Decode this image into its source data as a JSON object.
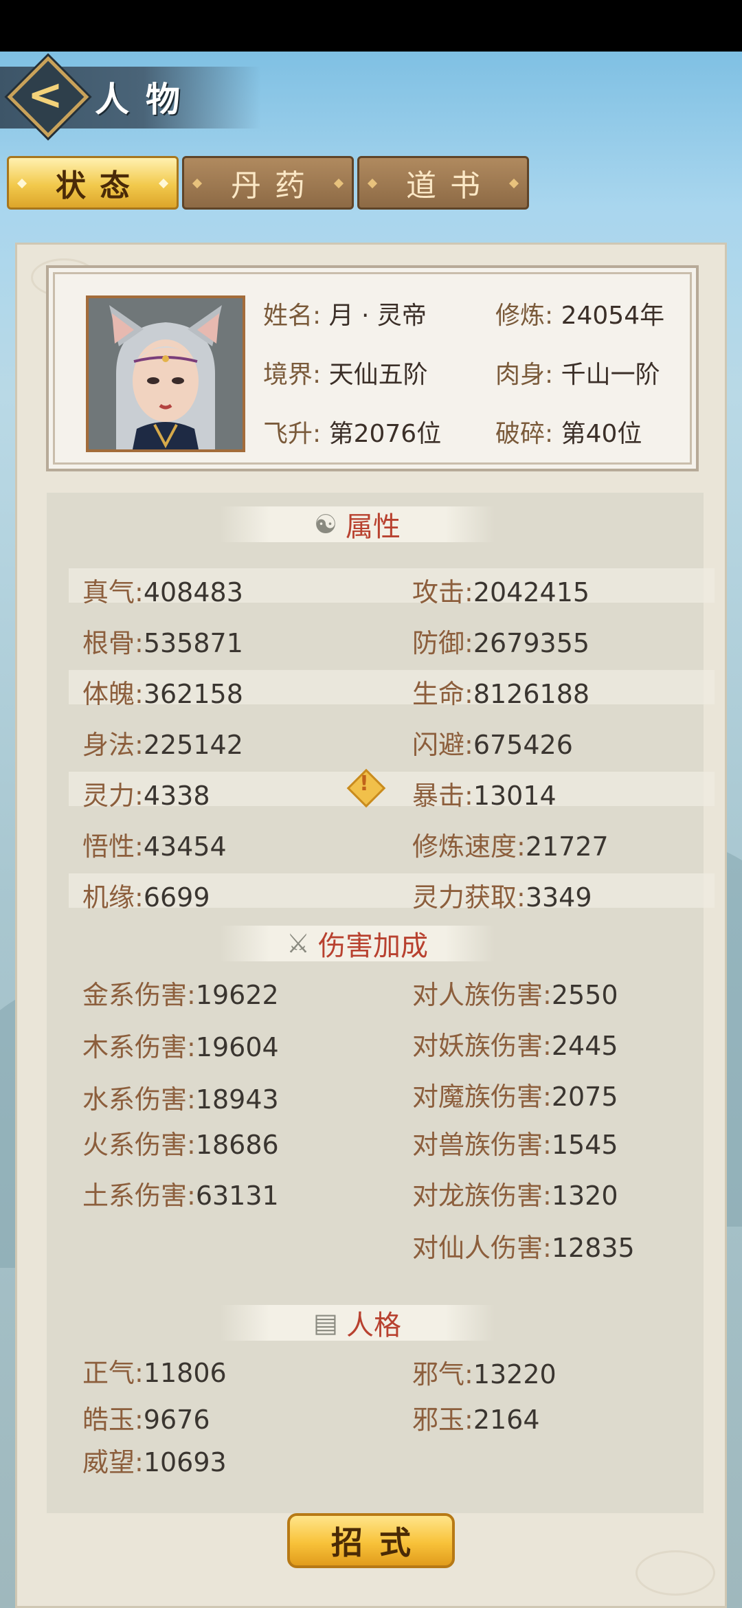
{
  "header": {
    "title": "人物"
  },
  "tabs": [
    {
      "label": "状态",
      "active": true
    },
    {
      "label": "丹药",
      "active": false
    },
    {
      "label": "道书",
      "active": false
    }
  ],
  "profile": {
    "name_label": "姓名:",
    "name": "月 · 灵帝",
    "cultivate_label": "修炼:",
    "cultivate": "24054年",
    "realm_label": "境界:",
    "realm": "天仙五阶",
    "body_label": "肉身:",
    "body": "千山一阶",
    "ascend_label": "飞升:",
    "ascend": "第2076位",
    "shatter_label": "破碎:",
    "shatter": "第40位"
  },
  "sections": {
    "attributes": "属性",
    "damage": "伤害加成",
    "personality": "人格"
  },
  "attributes": [
    {
      "k": "真气:",
      "v": "408483"
    },
    {
      "k": "根骨:",
      "v": "535871"
    },
    {
      "k": "体魄:",
      "v": "362158"
    },
    {
      "k": "身法:",
      "v": "225142"
    },
    {
      "k": "灵力:",
      "v": "4338"
    },
    {
      "k": "悟性:",
      "v": "43454"
    },
    {
      "k": "机缘:",
      "v": "6699"
    }
  ],
  "combat": [
    {
      "k": "攻击:",
      "v": "2042415"
    },
    {
      "k": "防御:",
      "v": "2679355"
    },
    {
      "k": "生命:",
      "v": "8126188"
    },
    {
      "k": "闪避:",
      "v": "675426"
    },
    {
      "k": "暴击:",
      "v": "13014"
    },
    {
      "k": "修炼速度:",
      "v": "21727"
    },
    {
      "k": "灵力获取:",
      "v": "3349"
    }
  ],
  "element_damage": [
    {
      "k": "金系伤害:",
      "v": "19622"
    },
    {
      "k": "木系伤害:",
      "v": "19604"
    },
    {
      "k": "水系伤害:",
      "v": "18943"
    },
    {
      "k": "火系伤害:",
      "v": "18686"
    },
    {
      "k": "土系伤害:",
      "v": "63131"
    }
  ],
  "race_damage": [
    {
      "k": "对人族伤害:",
      "v": "2550"
    },
    {
      "k": "对妖族伤害:",
      "v": "2445"
    },
    {
      "k": "对魔族伤害:",
      "v": "2075"
    },
    {
      "k": "对兽族伤害:",
      "v": "1545"
    },
    {
      "k": "对龙族伤害:",
      "v": "1320"
    },
    {
      "k": "对仙人伤害:",
      "v": "12835"
    }
  ],
  "personality_left": [
    {
      "k": "正气:",
      "v": "11806"
    },
    {
      "k": "皓玉:",
      "v": "9676"
    },
    {
      "k": "威望:",
      "v": "10693"
    }
  ],
  "personality_right": [
    {
      "k": "邪气:",
      "v": "13220"
    },
    {
      "k": "邪玉:",
      "v": "2164"
    }
  ],
  "bottom_button": "招式",
  "colors": {
    "accent_gold": "#f2c94c",
    "section_red": "#b8412f",
    "panel": "#eae5d8"
  }
}
